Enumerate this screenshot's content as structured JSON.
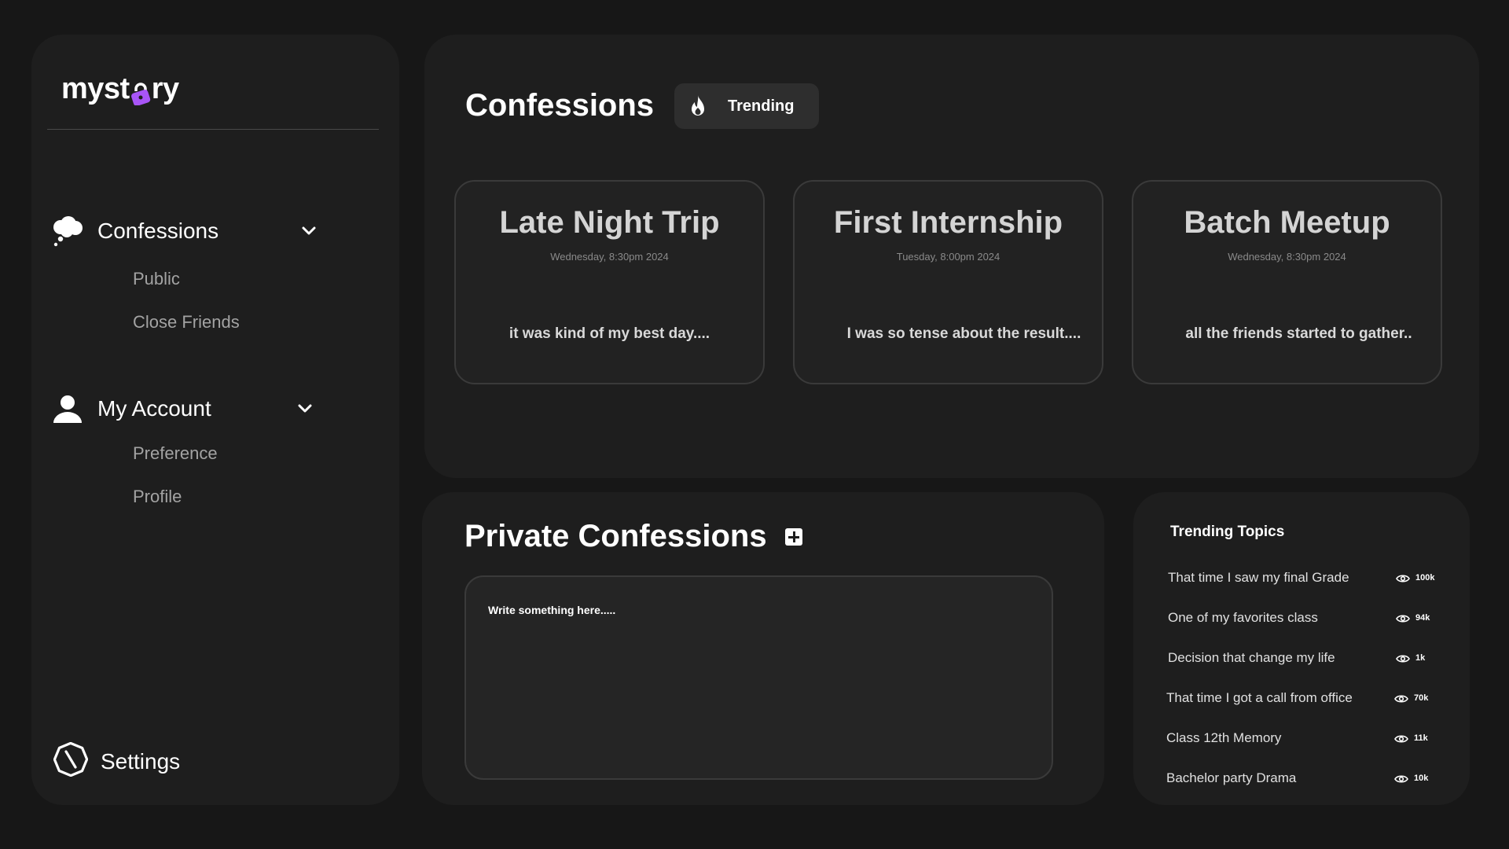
{
  "app": {
    "logo_prefix": "myst",
    "logo_suffix": "ry"
  },
  "sidebar": {
    "groups": [
      {
        "label": "Confessions",
        "icon": "thought-bubble-icon",
        "items": [
          "Public",
          "Close Friends"
        ]
      },
      {
        "label": "My Account",
        "icon": "user-icon",
        "items": [
          "Preference",
          "Profile"
        ]
      }
    ],
    "settings_label": "Settings"
  },
  "main": {
    "title": "Confessions",
    "trending_label": "Trending",
    "cards": [
      {
        "title": "Late Night Trip",
        "date": "Wednesday, 8:30pm 2024",
        "excerpt": "it was kind of my best day...."
      },
      {
        "title": "First Internship",
        "date": "Tuesday, 8:00pm 2024",
        "excerpt": "I was so tense about the result...."
      },
      {
        "title": "Batch Meetup",
        "date": "Wednesday, 8:30pm 2024",
        "excerpt": "all the friends started to gather.."
      }
    ]
  },
  "private": {
    "title": "Private Confessions",
    "placeholder": "Write something here....."
  },
  "trending_topics": {
    "title": "Trending Topics",
    "items": [
      {
        "text": "That time I saw my final Grade",
        "views": "100k"
      },
      {
        "text": "One of my favorites class",
        "views": "94k"
      },
      {
        "text": "Decision that change my life",
        "views": "1k"
      },
      {
        "text": "That time I got a call from office",
        "views": "70k"
      },
      {
        "text": "Class 12th Memory",
        "views": "11k"
      },
      {
        "text": "Bachelor party Drama",
        "views": "10k"
      }
    ]
  },
  "colors": {
    "background": "#171717",
    "panel": "#1e1e1e",
    "accent": "#a855f7"
  }
}
